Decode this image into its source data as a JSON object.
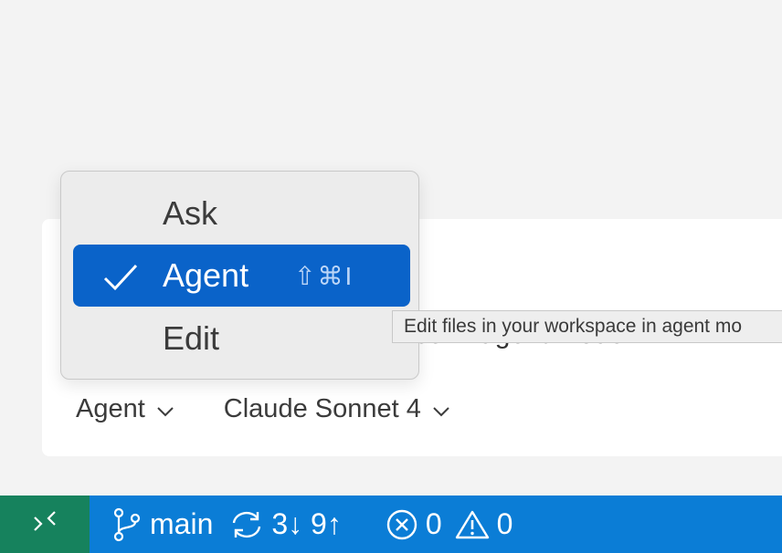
{
  "chat": {
    "input_text": "pace in agent mode",
    "mode_picker_label": "Agent",
    "model_picker_label": "Claude Sonnet 4"
  },
  "mode_menu": {
    "items": [
      {
        "label": "Ask",
        "selected": false,
        "shortcut": ""
      },
      {
        "label": "Agent",
        "selected": true,
        "shortcut": "⇧⌘I"
      },
      {
        "label": "Edit",
        "selected": false,
        "shortcut": ""
      }
    ]
  },
  "tooltip": {
    "text": "Edit files in your workspace in agent mo"
  },
  "statusbar": {
    "branch": "main",
    "sync": "3↓ 9↑",
    "errors": "0",
    "warnings": "0"
  },
  "colors": {
    "statusbar_bg": "#0b7dd6",
    "remote_bg": "#16825d",
    "selection_bg": "#0a63c9"
  }
}
